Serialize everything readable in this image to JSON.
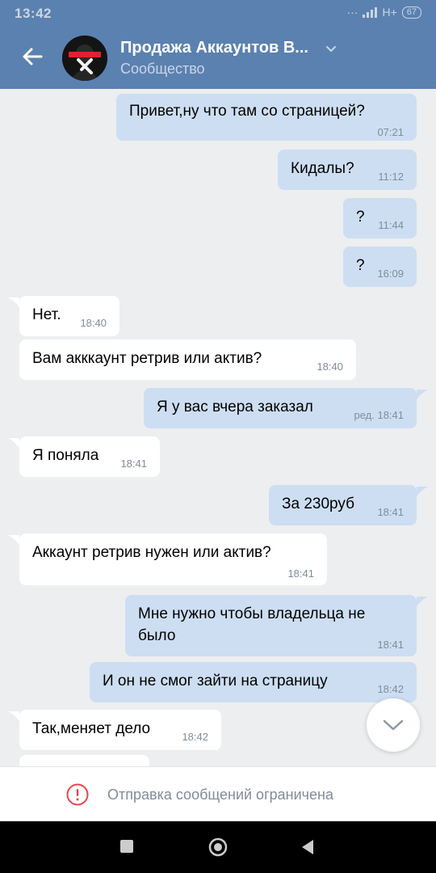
{
  "status_bar": {
    "time": "13:42",
    "network": "H+",
    "battery": "67"
  },
  "header": {
    "title": "Продажа Аккаунтов В...",
    "subtitle": "Сообщество"
  },
  "messages": [
    {
      "dir": "out",
      "text": "Привет,ну что там со страницей?",
      "time": "07:21"
    },
    {
      "dir": "out",
      "text": "Кидалы?",
      "time": "11:12"
    },
    {
      "dir": "out",
      "text": "?",
      "time": "11:44"
    },
    {
      "dir": "out",
      "text": "?",
      "time": "16:09"
    },
    {
      "dir": "in",
      "text": "Нет.",
      "time": "18:40"
    },
    {
      "dir": "in",
      "text": "Вам акккаунт ретрив или актив?",
      "time": "18:40"
    },
    {
      "dir": "out",
      "text": "Я у вас вчера заказал",
      "time": "ред. 18:41"
    },
    {
      "dir": "in",
      "text": "Я поняла",
      "time": "18:41"
    },
    {
      "dir": "out",
      "text": "За 230руб",
      "time": "18:41"
    },
    {
      "dir": "in",
      "text": "Аккаунт ретрив нужен или актив?",
      "time": "18:41"
    },
    {
      "dir": "out",
      "text_line1": "Мне нужно чтобы владельца не",
      "text_line2": "было",
      "time": "18:41"
    },
    {
      "dir": "out",
      "text": "И он не смог зайти на страницу",
      "time": "18:42"
    },
    {
      "dir": "in",
      "text": "Так,меняет дело",
      "time": "18:42"
    }
  ],
  "footer": {
    "restriction_text": "Отправка сообщений ограничена"
  },
  "colors": {
    "header_bg": "#5b81b0",
    "outgoing_bubble": "#cddef2",
    "incoming_bubble": "#ffffff",
    "chat_bg": "#edeef0",
    "restriction_icon": "#e64646"
  },
  "icons": [
    "back-arrow-icon",
    "chevron-down-icon",
    "scroll-down-icon",
    "alert-icon",
    "nav-square-icon",
    "nav-circle-icon",
    "nav-back-icon"
  ]
}
